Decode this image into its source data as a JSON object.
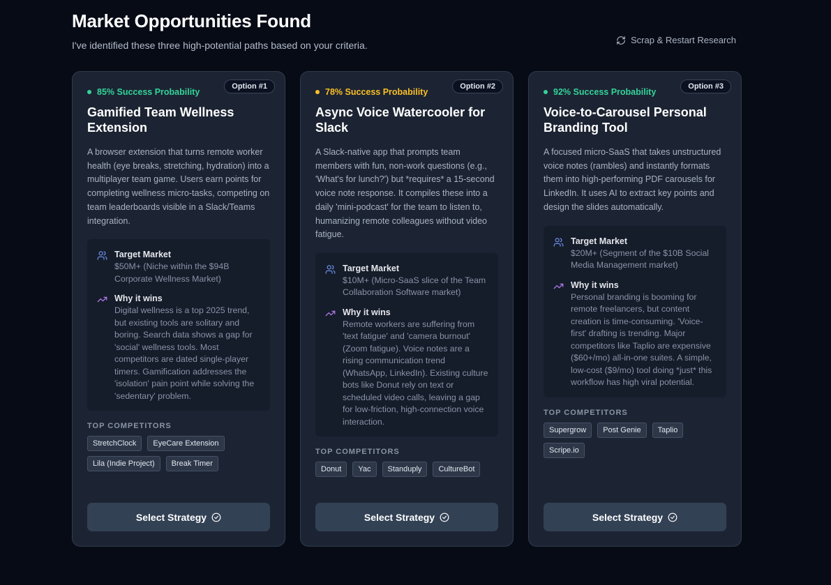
{
  "page": {
    "title": "Market Opportunities Found",
    "subtitle": "I've identified these three high-potential paths based on your criteria.",
    "restart_label": "Scrap & Restart Research",
    "restart_icon": "refresh-icon"
  },
  "labels": {
    "target_market": "Target Market",
    "why_it_wins": "Why it wins",
    "top_competitors": "TOP COMPETITORS",
    "select_strategy": "Select Strategy"
  },
  "colors": {
    "green": "#34d399",
    "yellow": "#fbbf24",
    "target_icon": "#6b8ee6",
    "trend_icon": "#b07ae8"
  },
  "cards": [
    {
      "option": "Option #1",
      "probability": "85% Success Probability",
      "probability_color": "#34d399",
      "title": "Gamified Team Wellness Extension",
      "description": "A browser extension that turns remote worker health (eye breaks, stretching, hydration) into a multiplayer team game. Users earn points for completing wellness micro-tasks, competing on team leaderboards visible in a Slack/Teams integration.",
      "target_market": "$50M+ (Niche within the $94B Corporate Wellness Market)",
      "why_it_wins": "Digital wellness is a top 2025 trend, but existing tools are solitary and boring. Search data shows a gap for 'social' wellness tools. Most competitors are dated single-player timers. Gamification addresses the 'isolation' pain point while solving the 'sedentary' problem.",
      "competitors": [
        "StretchClock",
        "EyeCare Extension",
        "Lila (Indie Project)",
        "Break Timer"
      ]
    },
    {
      "option": "Option #2",
      "probability": "78% Success Probability",
      "probability_color": "#fbbf24",
      "title": "Async Voice Watercooler for Slack",
      "description": "A Slack-native app that prompts team members with fun, non-work questions (e.g., 'What's for lunch?') but *requires* a 15-second voice note response. It compiles these into a daily 'mini-podcast' for the team to listen to, humanizing remote colleagues without video fatigue.",
      "target_market": "$10M+ (Micro-SaaS slice of the Team Collaboration Software market)",
      "why_it_wins": "Remote workers are suffering from 'text fatigue' and 'camera burnout' (Zoom fatigue). Voice notes are a rising communication trend (WhatsApp, LinkedIn). Existing culture bots like Donut rely on text or scheduled video calls, leaving a gap for low-friction, high-connection voice interaction.",
      "competitors": [
        "Donut",
        "Yac",
        "Standuply",
        "CultureBot"
      ]
    },
    {
      "option": "Option #3",
      "probability": "92% Success Probability",
      "probability_color": "#34d399",
      "title": "Voice-to-Carousel Personal Branding Tool",
      "description": "A focused micro-SaaS that takes unstructured voice notes (rambles) and instantly formats them into high-performing PDF carousels for LinkedIn. It uses AI to extract key points and design the slides automatically.",
      "target_market": "$20M+ (Segment of the $10B Social Media Management market)",
      "why_it_wins": "Personal branding is booming for remote freelancers, but content creation is time-consuming. 'Voice-first' drafting is trending. Major competitors like Taplio are expensive ($60+/mo) all-in-one suites. A simple, low-cost ($9/mo) tool doing *just* this workflow has high viral potential.",
      "competitors": [
        "Supergrow",
        "Post Genie",
        "Taplio",
        "Scripe.io"
      ]
    }
  ]
}
